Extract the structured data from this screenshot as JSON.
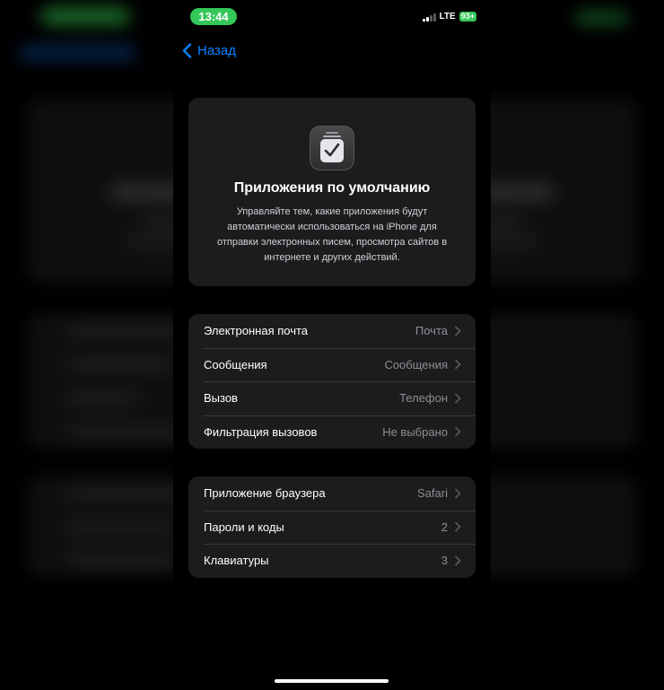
{
  "status_bar": {
    "time": "13:44",
    "network": "LTE",
    "battery": "93+"
  },
  "nav": {
    "back_label": "Назад"
  },
  "hero": {
    "icon": "checklist-icon",
    "title": "Приложения по умолчанию",
    "description": "Управляйте тем, какие приложения будут автоматически использоваться на iPhone для отправки электронных писем, просмотра сайтов в интернете и других действий."
  },
  "group1": {
    "rows": [
      {
        "label": "Электронная почта",
        "value": "Почта"
      },
      {
        "label": "Сообщения",
        "value": "Сообщения"
      },
      {
        "label": "Вызов",
        "value": "Телефон"
      },
      {
        "label": "Фильтрация вызовов",
        "value": "Не выбрано"
      }
    ]
  },
  "group2": {
    "rows": [
      {
        "label": "Приложение браузера",
        "value": "Safari"
      },
      {
        "label": "Пароли и коды",
        "value": "2"
      },
      {
        "label": "Клавиатуры",
        "value": "3"
      }
    ]
  },
  "colors": {
    "accent": "#0a84ff",
    "status_green": "#34c759",
    "card_bg": "#1c1c1e"
  }
}
